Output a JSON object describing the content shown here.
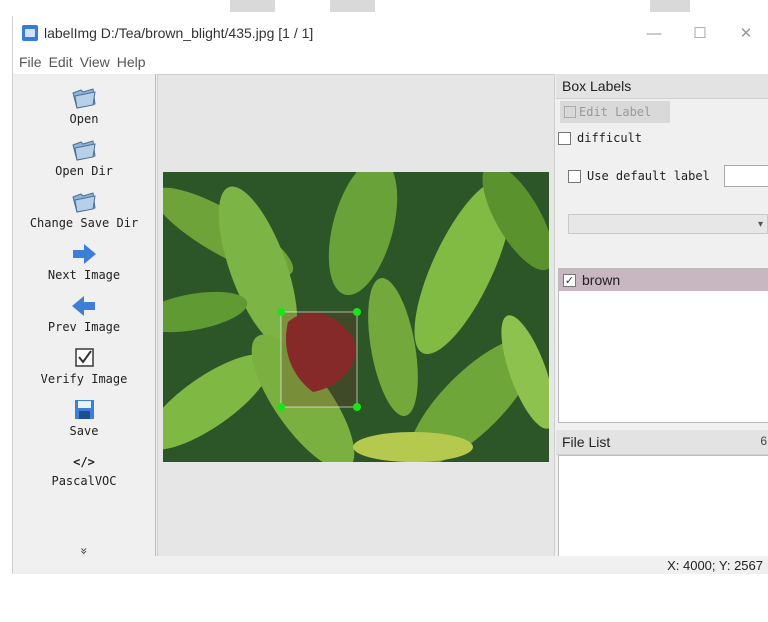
{
  "window": {
    "title": "labelImg D:/Tea/brown_blight/435.jpg [1 / 1]",
    "controls": {
      "minimize": "—",
      "maximize": "☐",
      "close": "✕"
    }
  },
  "menu": [
    "File",
    "Edit",
    "View",
    "Help"
  ],
  "toolbar": {
    "items": [
      {
        "label": "Open",
        "icon": "folder-icon"
      },
      {
        "label": "Open Dir",
        "icon": "folder-icon"
      },
      {
        "label": "Change Save Dir",
        "icon": "folder-icon"
      },
      {
        "label": "Next Image",
        "icon": "arrow-right-icon"
      },
      {
        "label": "Prev Image",
        "icon": "arrow-left-icon"
      },
      {
        "label": "Verify Image",
        "icon": "check-box-icon"
      },
      {
        "label": "Save",
        "icon": "floppy-icon"
      },
      {
        "label": "PascalVOC",
        "icon": "code-icon",
        "glyph": "</>"
      }
    ],
    "more": "»"
  },
  "box_labels": {
    "title": "Box Labels",
    "edit_label": "Edit Label",
    "difficult": "difficult",
    "use_default_label": "Use default label",
    "labels": [
      {
        "name": "brown",
        "checked": true
      }
    ]
  },
  "file_list": {
    "title": "File List"
  },
  "status": {
    "coords": "X: 4000; Y: 2567"
  },
  "colors": {
    "annotation_fill": "#8b2a2a",
    "vertex": "#19e619",
    "label_row_bg": "#c8b7c0",
    "leaf_dark": "#2f5b2a",
    "leaf_light": "#7fbf3f"
  }
}
